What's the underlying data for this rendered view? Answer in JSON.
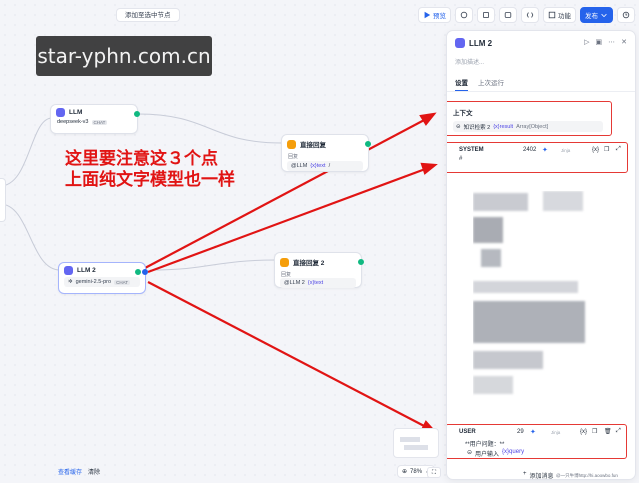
{
  "topbar": {
    "add_selected_node": "添加至选中节点"
  },
  "toolbar": {
    "preview": "预览",
    "features": "功能",
    "publish": "发布"
  },
  "watermark": "star-yphn.com.cn",
  "annotation": {
    "line1": "这里要注意这３个点",
    "line2": "上面纯文字模型也一样"
  },
  "nodes": {
    "llm_top": {
      "title": "LLM",
      "model": "deepseek-v3",
      "badge": "CHAT"
    },
    "reply_top": {
      "title": "直接回复",
      "label": "回复",
      "value_prefix": "@LLM",
      "value_var": "{x}text",
      "value_suffix": "/"
    },
    "llm2": {
      "title": "LLM 2",
      "model": "gemini-2.5-pro",
      "badge": "CHAT"
    },
    "reply2": {
      "title": "直接回复 2",
      "label": "回复",
      "value_prefix": "@LLM 2",
      "value_var": "{x}text"
    }
  },
  "panel": {
    "title": "LLM 2",
    "desc_placeholder": "添加描述...",
    "tabs": [
      "设置",
      "上次运行"
    ],
    "context": {
      "label": "上下文",
      "source": "知识检索 2",
      "var": "{x}result",
      "type": "Array[Object]"
    },
    "system": {
      "label": "SYSTEM",
      "count": "2402",
      "jinja": "Jinja",
      "var_btn": "{x}",
      "hash": "#"
    },
    "user": {
      "label": "USER",
      "count": "29",
      "jinja": "Jinja",
      "var_btn": "{x}",
      "line1": "**用户问题：**",
      "line2_prefix": "用户输入",
      "line2_var": "{x}query"
    },
    "add_message": "添加消息"
  },
  "bottom": {
    "view_cache": "查看缓存",
    "clear": "清除",
    "zoom": "78%",
    "credit": "@一只牛博http://hi.aoowbo.fun"
  },
  "colors": {
    "accent": "#2563eb",
    "annotation_red": "#e11414",
    "llm_icon": "#6366f1",
    "reply_icon": "#f59e0b"
  }
}
